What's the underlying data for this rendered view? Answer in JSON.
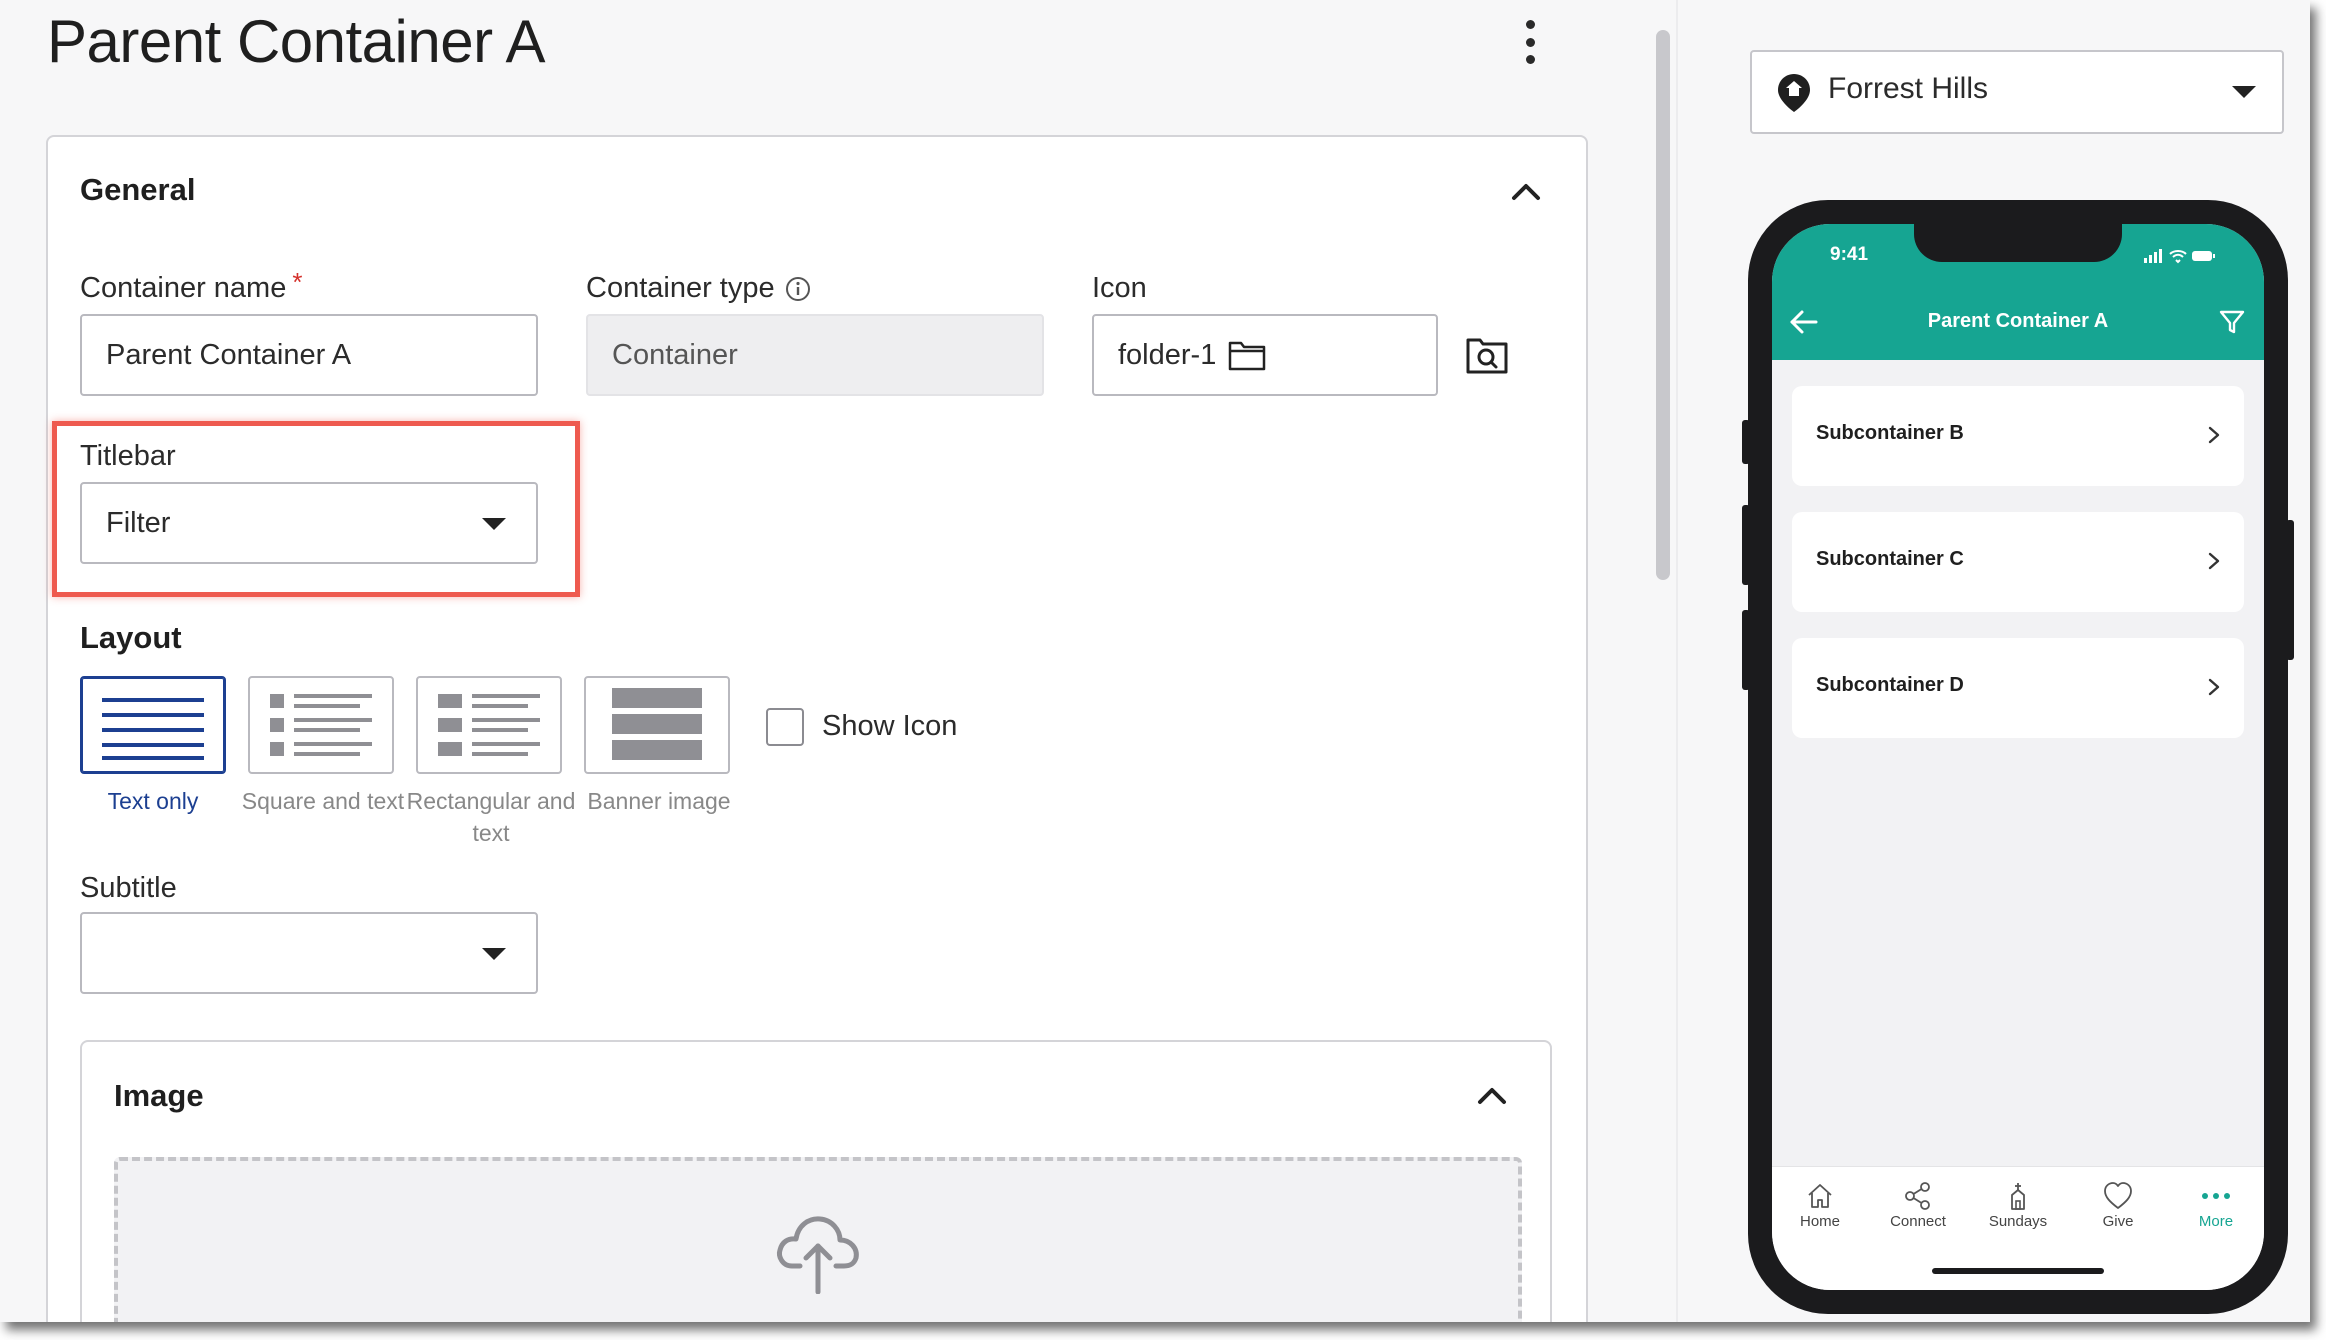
{
  "header": {
    "title": "Parent Container A",
    "more_icon": "more-vertical-icon"
  },
  "general": {
    "title": "General",
    "container_name": {
      "label": "Container name",
      "required_mark": "*",
      "value": "Parent Container A"
    },
    "container_type": {
      "label": "Container type",
      "value": "Container"
    },
    "icon": {
      "label": "Icon",
      "value": "folder-1"
    },
    "titlebar": {
      "label": "Titlebar",
      "value": "Filter"
    },
    "layout": {
      "label": "Layout",
      "options": [
        {
          "label": "Text only",
          "selected": true
        },
        {
          "label": "Square and text",
          "selected": false
        },
        {
          "label": "Rectangular and text",
          "selected": false
        },
        {
          "label": "Banner image",
          "selected": false
        }
      ],
      "show_icon_label": "Show Icon",
      "show_icon_checked": false
    },
    "subtitle": {
      "label": "Subtitle",
      "value": ""
    }
  },
  "image_section": {
    "title": "Image"
  },
  "preview": {
    "location": "Forrest Hills",
    "phone": {
      "time": "9:41",
      "title": "Parent Container A",
      "items": [
        "Subcontainer B",
        "Subcontainer C",
        "Subcontainer D"
      ],
      "tabs": [
        {
          "label": "Home",
          "active": false
        },
        {
          "label": "Connect",
          "active": false
        },
        {
          "label": "Sundays",
          "active": false
        },
        {
          "label": "Give",
          "active": false
        },
        {
          "label": "More",
          "active": true
        }
      ]
    }
  },
  "colors": {
    "accent": "#16a592",
    "selection": "#1c3f91",
    "highlight": "#ee5a4f",
    "required": "#d4302b"
  }
}
